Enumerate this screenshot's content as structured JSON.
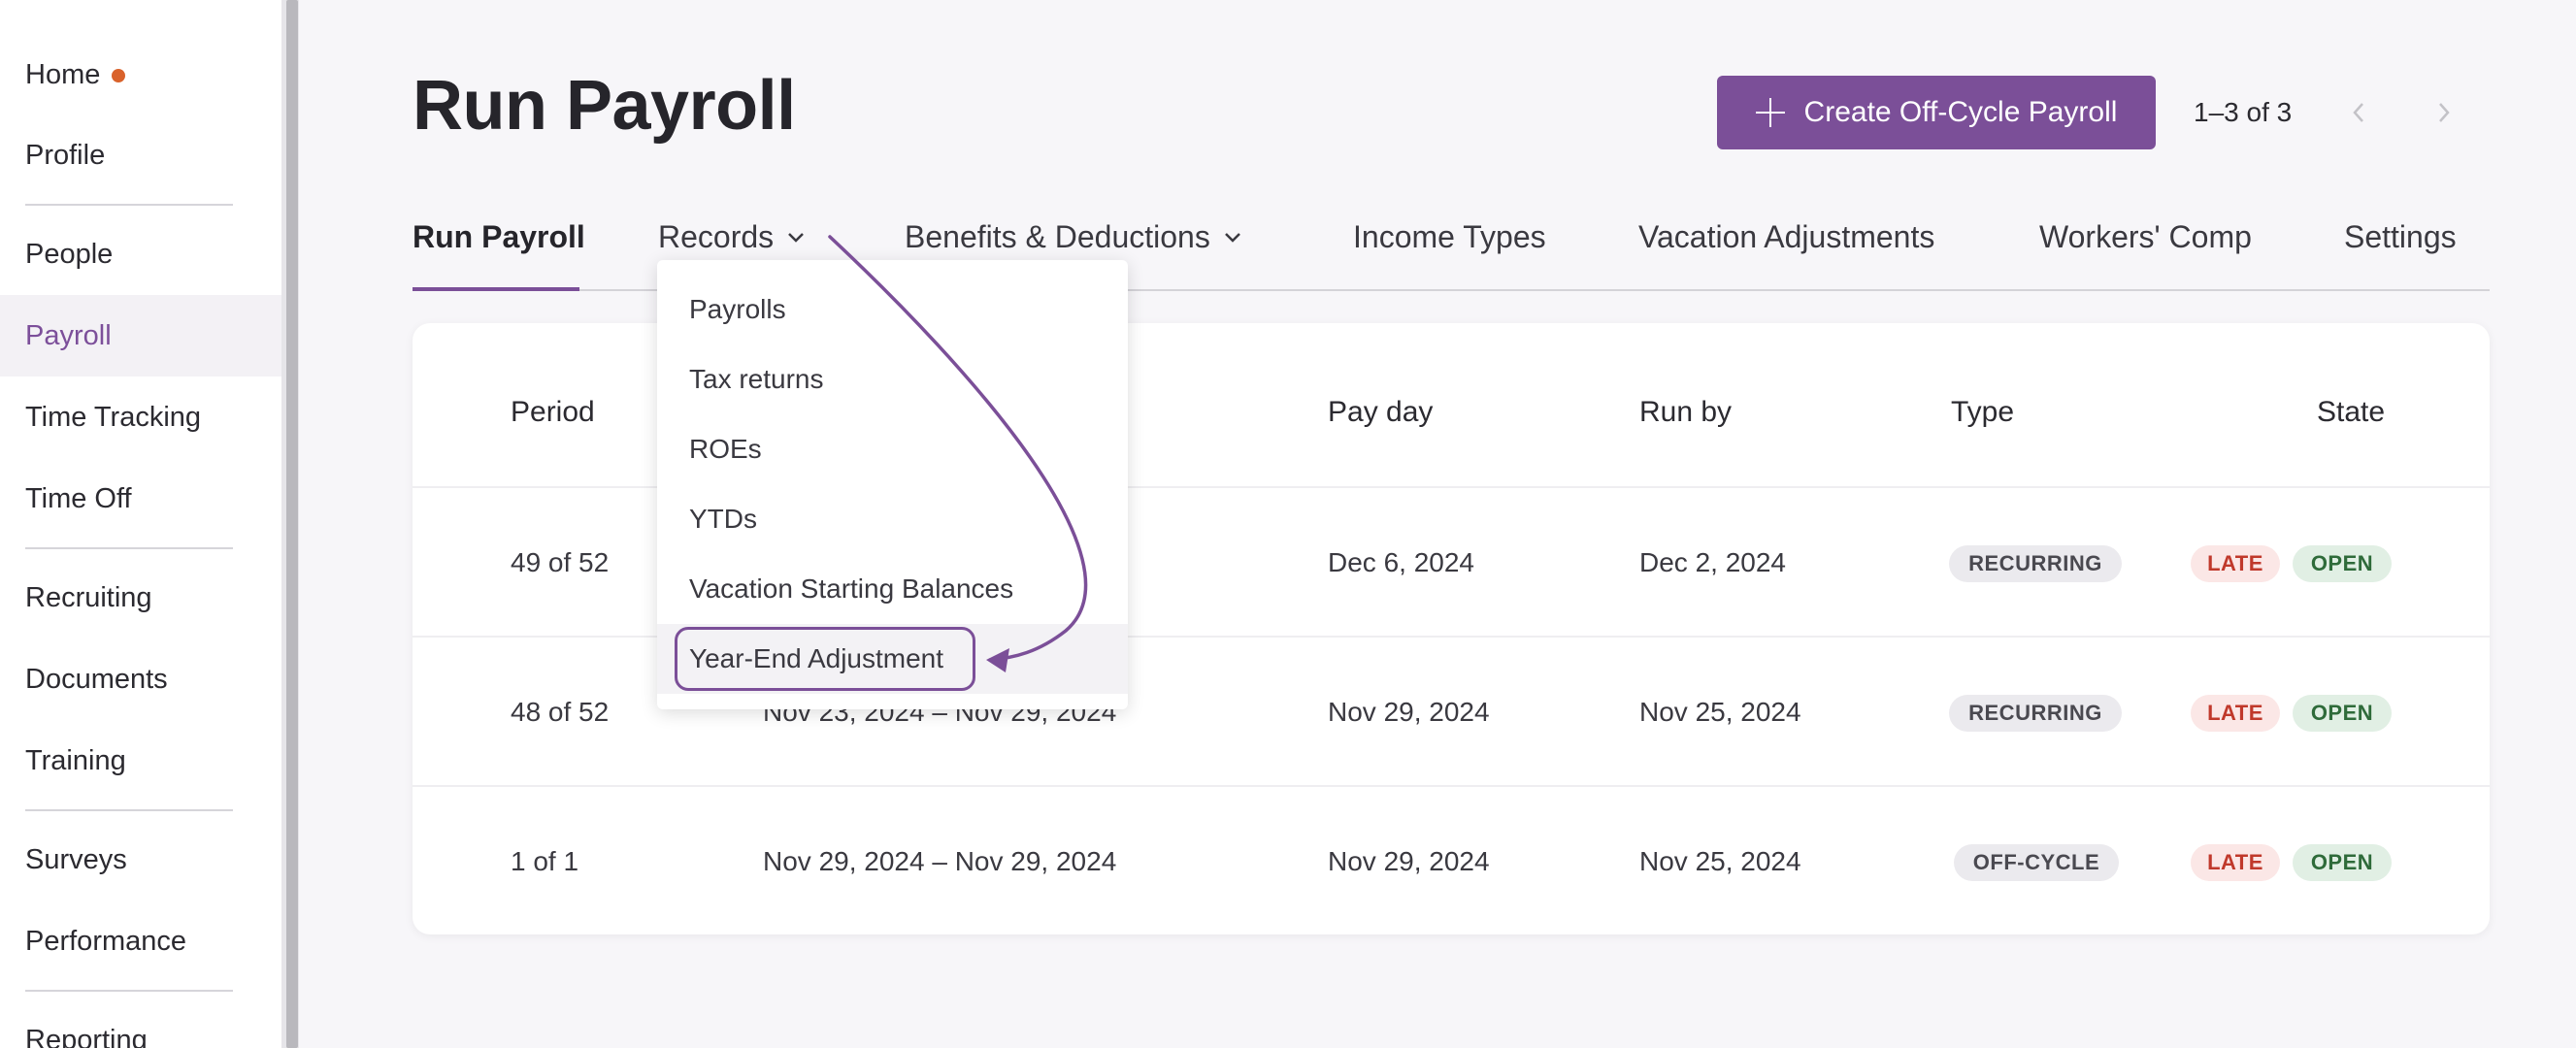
{
  "sidebar": {
    "items": [
      {
        "label": "Home",
        "badge_dot": true
      },
      {
        "label": "Profile"
      },
      {
        "label": "People"
      },
      {
        "label": "Payroll",
        "active": true
      },
      {
        "label": "Time Tracking"
      },
      {
        "label": "Time Off"
      },
      {
        "label": "Recruiting"
      },
      {
        "label": "Documents"
      },
      {
        "label": "Training"
      },
      {
        "label": "Surveys"
      },
      {
        "label": "Performance"
      },
      {
        "label": "Reporting"
      }
    ]
  },
  "header": {
    "title": "Run Payroll",
    "create_button_label": "Create Off-Cycle Payroll",
    "pager_text": "1–3 of 3"
  },
  "tabs": [
    {
      "label": "Run Payroll",
      "active": true
    },
    {
      "label": "Records",
      "has_dropdown": true
    },
    {
      "label": "Benefits & Deductions",
      "has_dropdown": true
    },
    {
      "label": "Income Types"
    },
    {
      "label": "Vacation Adjustments"
    },
    {
      "label": "Workers' Comp"
    },
    {
      "label": "Settings"
    }
  ],
  "records_menu": {
    "items": [
      {
        "label": "Payrolls"
      },
      {
        "label": "Tax returns"
      },
      {
        "label": "ROEs"
      },
      {
        "label": "YTDs"
      },
      {
        "label": "Vacation Starting Balances"
      },
      {
        "label": "Year-End Adjustment",
        "highlighted": true
      }
    ]
  },
  "table": {
    "headers": [
      "Period",
      "Pay day",
      "Run by",
      "Type",
      "State"
    ],
    "rows": [
      {
        "period": "49 of 52",
        "range": "",
        "pay_day": "Dec 6, 2024",
        "run_by": "Dec 2, 2024",
        "type": "RECURRING",
        "late": "LATE",
        "state": "OPEN"
      },
      {
        "period": "48 of 52",
        "range": "Nov 23, 2024 – Nov 29, 2024",
        "pay_day": "Nov 29, 2024",
        "run_by": "Nov 25, 2024",
        "type": "RECURRING",
        "late": "LATE",
        "state": "OPEN"
      },
      {
        "period": "1 of 1",
        "range": "Nov 29, 2024 – Nov 29, 2024",
        "pay_day": "Nov 29, 2024",
        "run_by": "Nov 25, 2024",
        "type": "OFF-CYCLE",
        "late": "LATE",
        "state": "OPEN"
      }
    ]
  },
  "colors": {
    "accent": "#7b4f98",
    "home_dot": "#d9622b",
    "late": "#c0392b",
    "open": "#2f6b3a"
  }
}
